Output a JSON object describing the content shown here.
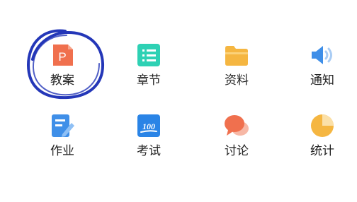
{
  "menu": {
    "items": [
      {
        "label": "教案",
        "icon": "ppt-file-icon",
        "color": "#F0704E"
      },
      {
        "label": "章节",
        "icon": "list-icon",
        "color": "#2ED1B4"
      },
      {
        "label": "资料",
        "icon": "folder-icon",
        "color": "#F5B641"
      },
      {
        "label": "通知",
        "icon": "speaker-icon",
        "color": "#3F8FE8"
      },
      {
        "label": "作业",
        "icon": "homework-icon",
        "color": "#3F8FE8"
      },
      {
        "label": "考试",
        "icon": "exam-100-icon",
        "color": "#2A84E6"
      },
      {
        "label": "讨论",
        "icon": "discussion-icon",
        "color": "#F0704E"
      },
      {
        "label": "统计",
        "icon": "pie-chart-icon",
        "color": "#F5B641"
      }
    ]
  },
  "icon_text": {
    "ppt": "P",
    "score": "100"
  },
  "annotation": {
    "color": "#2437B8",
    "target": "教案"
  }
}
